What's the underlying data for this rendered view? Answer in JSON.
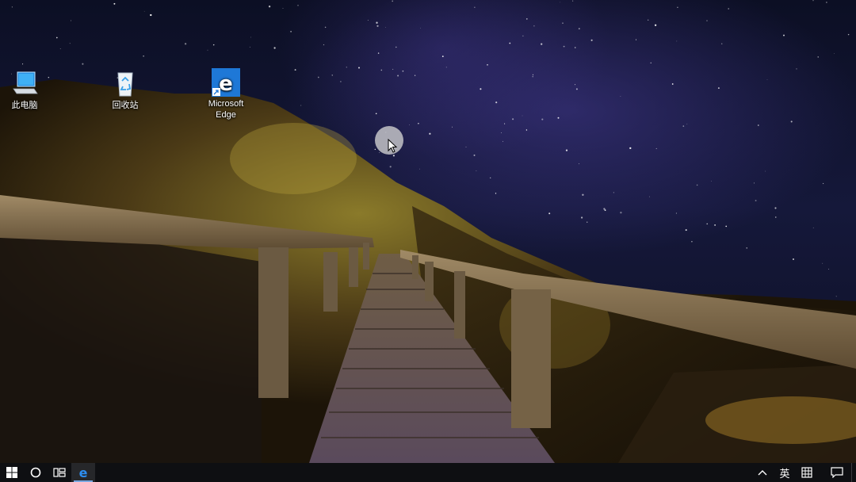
{
  "desktop": {
    "icons": [
      {
        "name": "this-pc",
        "label": "此电脑",
        "icon": "computer-icon"
      },
      {
        "name": "recycle-bin",
        "label": "回收站",
        "icon": "recycle-bin-icon"
      },
      {
        "name": "microsoft-edge",
        "label": "Microsoft\nEdge",
        "icon": "edge-icon"
      }
    ]
  },
  "taskbar": {
    "start": {
      "icon": "windows-start-icon"
    },
    "cortana": {
      "icon": "cortana-circle-icon"
    },
    "task_view": {
      "icon": "task-view-icon"
    },
    "pinned": [
      {
        "name": "edge",
        "icon": "edge-icon",
        "active": true
      }
    ],
    "tray": {
      "overflow": {
        "icon": "chevron-up-icon"
      },
      "ime_label": "英",
      "ime_mode": {
        "icon": "ime-grid-icon"
      },
      "action_center": {
        "icon": "notification-icon"
      }
    }
  },
  "colors": {
    "taskbar_bg": "#0e0f12",
    "edge_blue": "#1e78d7",
    "active_indicator": "#7aa7e0"
  }
}
